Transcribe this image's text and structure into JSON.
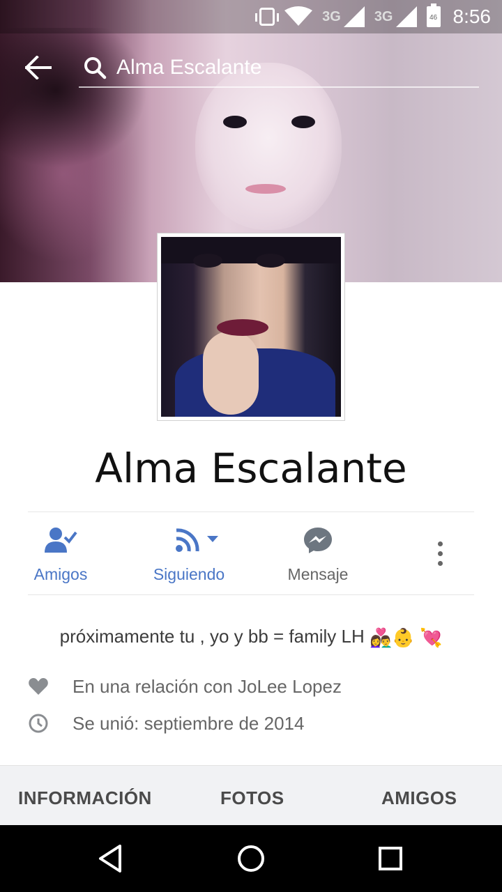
{
  "status_bar": {
    "network_1": "3G",
    "network_2": "3G",
    "battery_label": "46",
    "time": "8:56",
    "icons": [
      "vibrate-icon",
      "wifi-icon",
      "signal-icon",
      "signal-icon",
      "battery-icon"
    ]
  },
  "header": {
    "back_icon": "arrow-left-icon",
    "search_icon": "search-icon",
    "search_query": "Alma Escalante"
  },
  "profile": {
    "name": "Alma Escalante"
  },
  "actions": {
    "friends_label": "Amigos",
    "following_label": "Siguiendo",
    "message_label": "Mensaje",
    "more_icon": "more-vertical-icon"
  },
  "bio": {
    "text": "próximamente tu , yo y bb = family LH",
    "emojis": "👩‍❤️‍👨👶 💘"
  },
  "details": {
    "relationship": "En una relación con JoLee Lopez",
    "joined": "Se unió: septiembre de 2014"
  },
  "tabs": {
    "info": "INFORMACIÓN",
    "photos": "FOTOS",
    "friends": "AMIGOS"
  },
  "colors": {
    "accent": "#4a76c6",
    "message_icon": "#6d7680",
    "tab_bg": "#f1f2f4"
  }
}
